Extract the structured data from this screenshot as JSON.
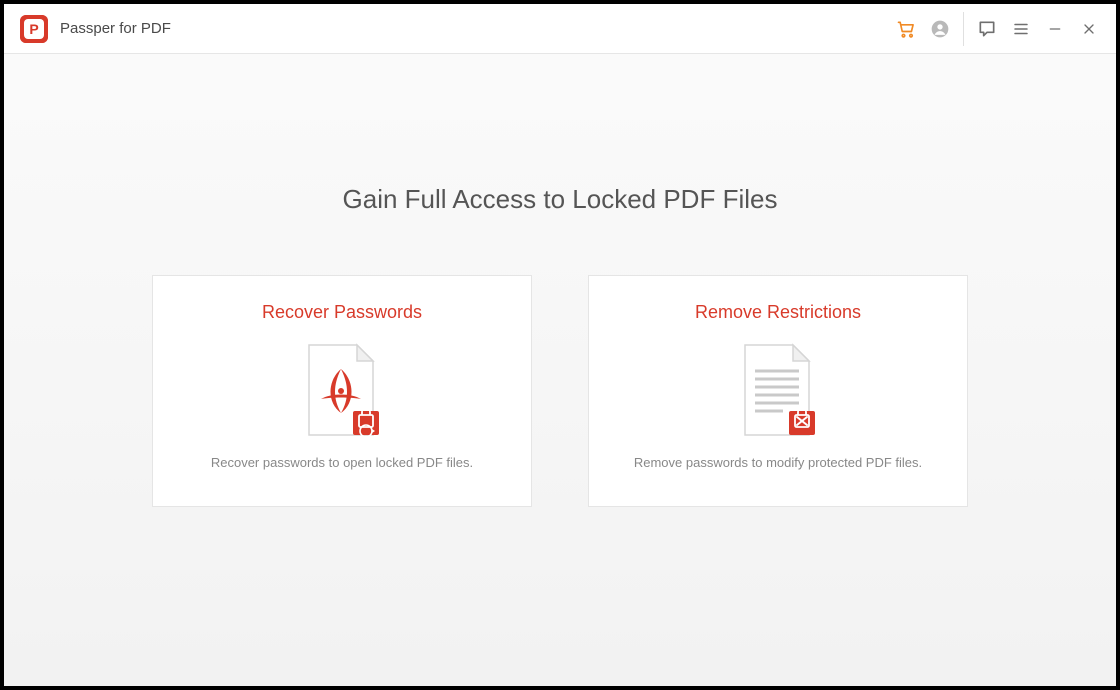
{
  "app": {
    "title": "Passper for PDF",
    "logo_letter": "P"
  },
  "headline": "Gain Full Access to Locked PDF Files",
  "cards": {
    "recover": {
      "title": "Recover Passwords",
      "desc": "Recover passwords to open locked PDF files."
    },
    "remove": {
      "title": "Remove Restrictions",
      "desc": "Remove passwords to modify protected PDF files."
    }
  },
  "colors": {
    "accent": "#d83a2a",
    "cart": "#f08a25"
  }
}
